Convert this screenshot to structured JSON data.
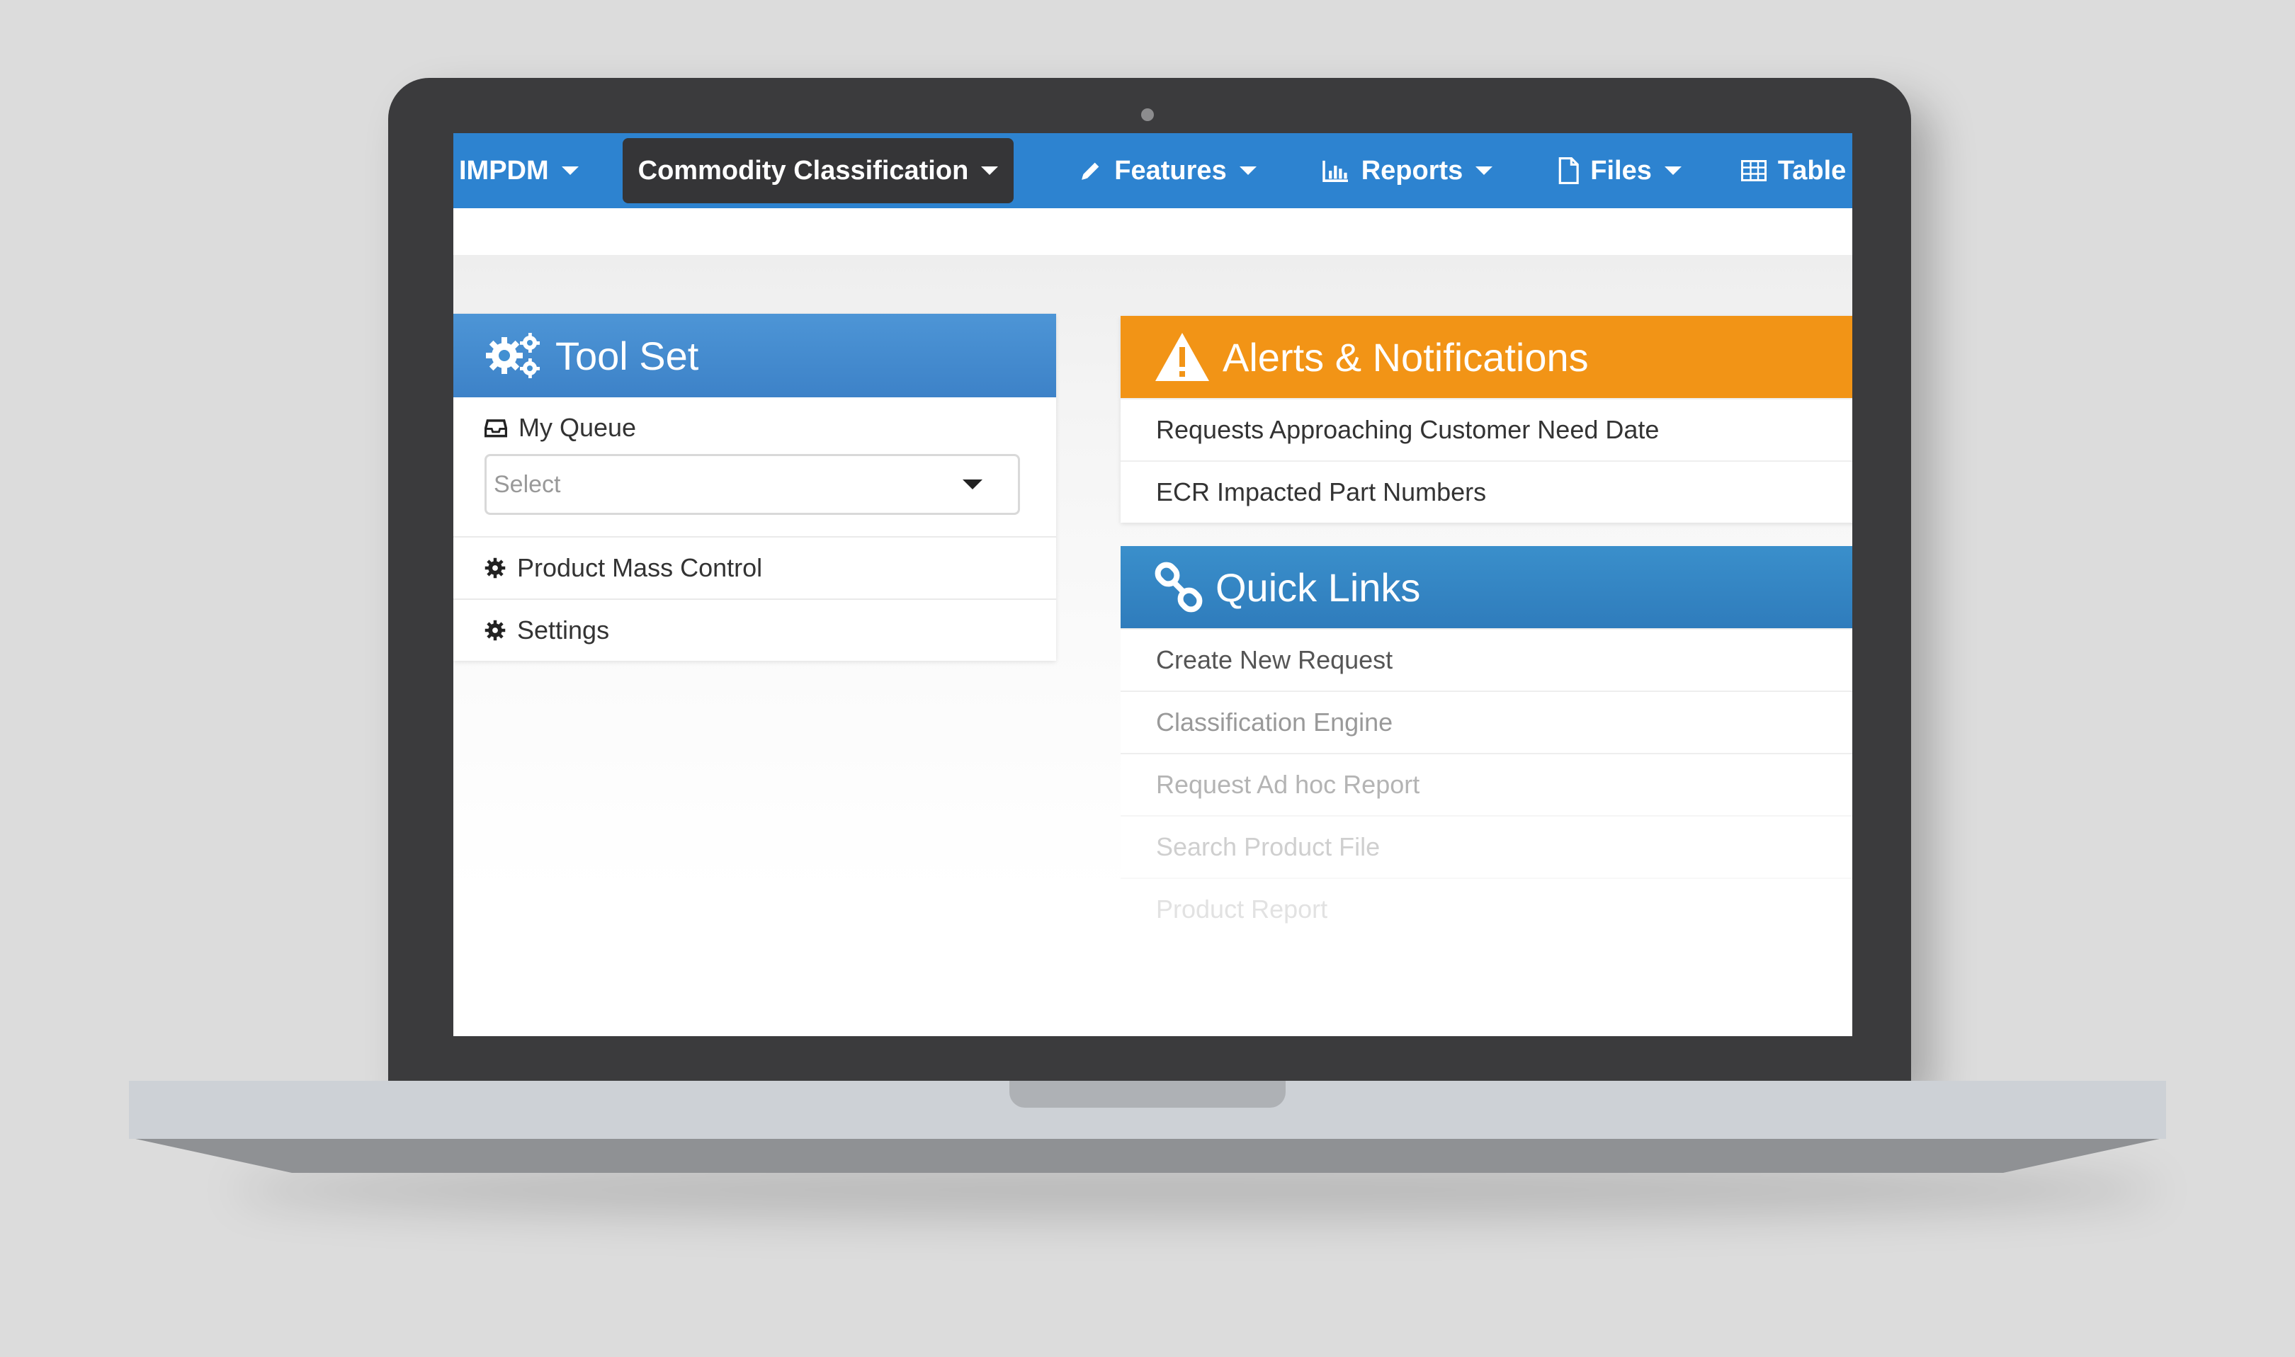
{
  "navbar": {
    "items": [
      {
        "label": "IMPDM"
      },
      {
        "label": "Commodity Classification"
      },
      {
        "label": "Features"
      },
      {
        "label": "Reports"
      },
      {
        "label": "Files"
      },
      {
        "label": "Table"
      }
    ]
  },
  "toolset": {
    "title": "Tool Set",
    "queue_label": "My Queue",
    "select_placeholder": "Select",
    "items": [
      {
        "label": "Product Mass Control"
      },
      {
        "label": "Settings"
      }
    ]
  },
  "alerts": {
    "title": "Alerts & Notifications",
    "items": [
      {
        "label": "Requests Approaching Customer Need Date"
      },
      {
        "label": "ECR Impacted Part Numbers"
      }
    ]
  },
  "quick_links": {
    "title": "Quick Links",
    "items": [
      {
        "label": "Create New Request"
      },
      {
        "label": "Classification Engine"
      },
      {
        "label": "Request Ad hoc Report"
      },
      {
        "label": "Search Product File"
      },
      {
        "label": "Product Report"
      }
    ]
  },
  "colors": {
    "nav_bar": "#2d83d0",
    "nav_active": "#353537",
    "toolset_header": "#4290d2",
    "alerts_header": "#f29416",
    "quicklinks_header": "#3585c4"
  }
}
